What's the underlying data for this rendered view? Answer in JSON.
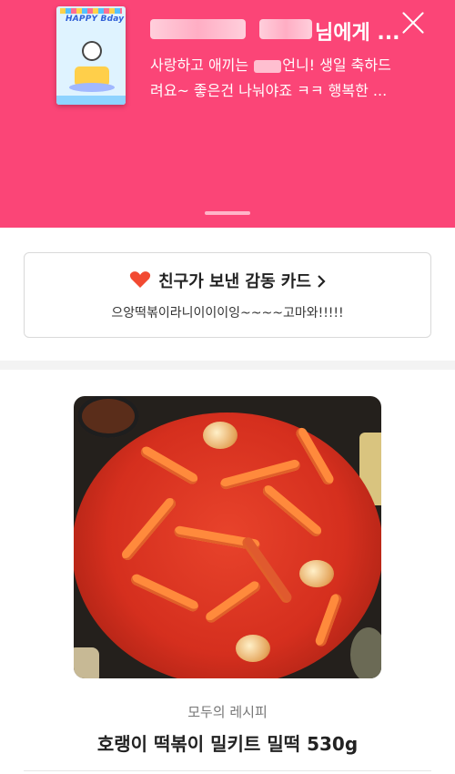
{
  "header": {
    "recipient_suffix": "님에게 ...",
    "message_part1": "사랑하고 애끼는 ",
    "message_part2": "언니! 생일 축하드",
    "message_line2": "려요~ 좋은건 나눠야죠 ㅋㅋ 행복한 ...",
    "card_image_text": "HAPPY Bday",
    "colors": {
      "background": "#fb4577",
      "text": "#ffffff"
    }
  },
  "card_button": {
    "title": "친구가 보낸 감동 카드",
    "subtitle": "으앙떡볶이라니이이이잉~~~~고마와!!!!!",
    "icon": "heart-icon",
    "chevron_icon": "chevron-right-icon",
    "heart_color": "#f24a32"
  },
  "product": {
    "brand": "모두의 레시피",
    "name": "호랭이 떡볶이 밀키트 밀떡 530g"
  }
}
